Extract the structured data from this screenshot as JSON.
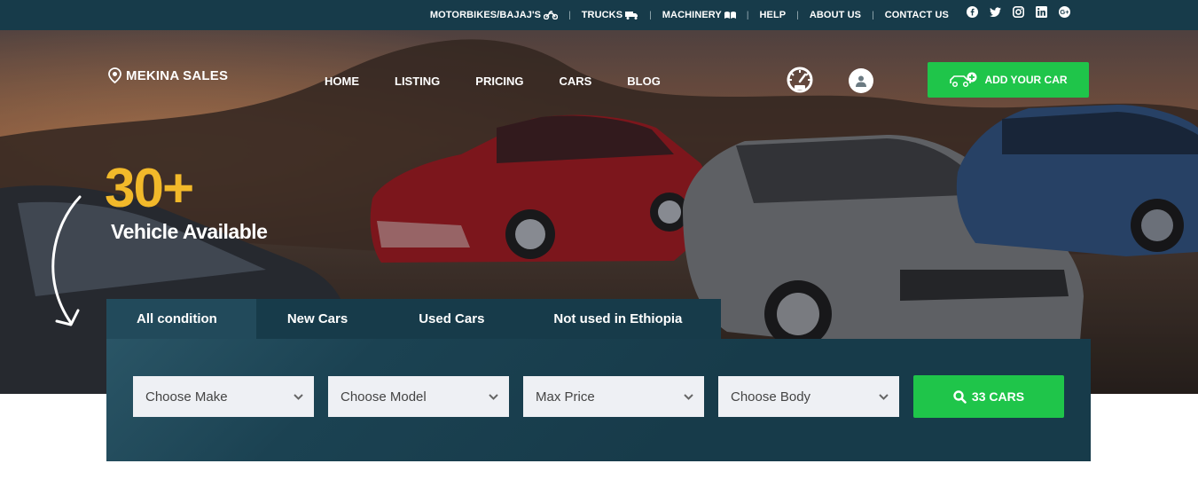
{
  "topbar": {
    "links": [
      {
        "label": "MOTORBIKES/BAJAJ'S",
        "icon": "motorbike-icon"
      },
      {
        "label": "TRUCKS",
        "icon": "truck-icon"
      },
      {
        "label": "MACHINERY",
        "icon": "machinery-icon"
      },
      {
        "label": "HELP",
        "icon": ""
      },
      {
        "label": "ABOUT US",
        "icon": ""
      },
      {
        "label": "CONTACT US",
        "icon": ""
      }
    ],
    "social": [
      "facebook-icon",
      "twitter-icon",
      "instagram-icon",
      "linkedin-icon",
      "google-plus-icon"
    ]
  },
  "header": {
    "logo": "MEKINA SALES",
    "nav": [
      "HOME",
      "LISTING",
      "PRICING",
      "CARS",
      "BLOG"
    ],
    "add_car_label": "ADD YOUR CAR"
  },
  "hero": {
    "count": "30+",
    "subtitle": "Vehicle Available"
  },
  "search": {
    "tabs": [
      "All condition",
      "New Cars",
      "Used Cars",
      "Not used in Ethiopia"
    ],
    "active_tab": 0,
    "selects": [
      {
        "value": "Choose Make"
      },
      {
        "value": "Choose Model"
      },
      {
        "value": "Max Price"
      },
      {
        "value": "Choose Body"
      }
    ],
    "button_label": "33 CARS"
  },
  "colors": {
    "topbar": "#173b4a",
    "accent_green": "#1fc54a",
    "count_yellow": "#f2b92a"
  }
}
